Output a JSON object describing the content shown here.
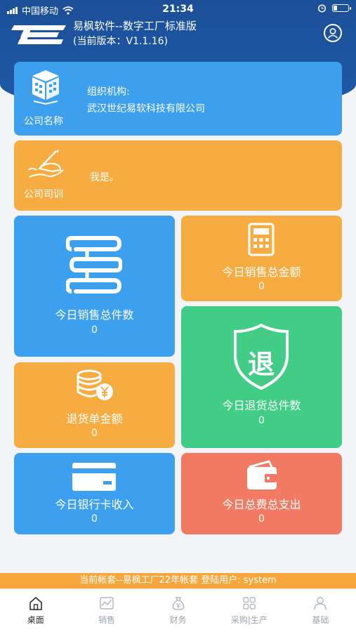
{
  "status_bar": {
    "carrier": "中国移动",
    "time": "21:34"
  },
  "app": {
    "name": "易枫软件--数字工厂标准版",
    "version": "(当前版本：V1.1.16)"
  },
  "company": {
    "icon_label": "公司名称",
    "title": "组织机构:",
    "name": "武汉世纪易软科技有限公司"
  },
  "motto": {
    "icon_label": "公司司训",
    "text": "我是。"
  },
  "tiles": {
    "sales_qty": {
      "title": "今日销售总件数",
      "value": "0"
    },
    "sales_amount": {
      "title": "今日销售总金额",
      "value": "0"
    },
    "return_amount": {
      "title": "退货单金额",
      "value": "0"
    },
    "return_qty": {
      "title": "今日退货总件数",
      "value": "0",
      "glyph": "退"
    },
    "bank_income": {
      "title": "今日银行卡收入",
      "value": "0"
    },
    "expense": {
      "title": "今日总费总支出",
      "value": "0"
    }
  },
  "banner": {
    "text": "当前帐套--易枫工厂22年帐套   登陆用户: system"
  },
  "tabs": [
    {
      "label": "桌面",
      "icon": "home-icon",
      "active": true
    },
    {
      "label": "销售",
      "icon": "chart-icon",
      "active": false
    },
    {
      "label": "财务",
      "icon": "money-bag-icon",
      "active": false
    },
    {
      "label": "采购|生产",
      "icon": "grid-icon",
      "active": false
    },
    {
      "label": "基础",
      "icon": "person-icon",
      "active": false
    }
  ],
  "colors": {
    "header": "#1f5aa8",
    "blue": "#3da0ee",
    "orange": "#f6ac40",
    "green": "#42cd86",
    "coral": "#f27a63"
  }
}
